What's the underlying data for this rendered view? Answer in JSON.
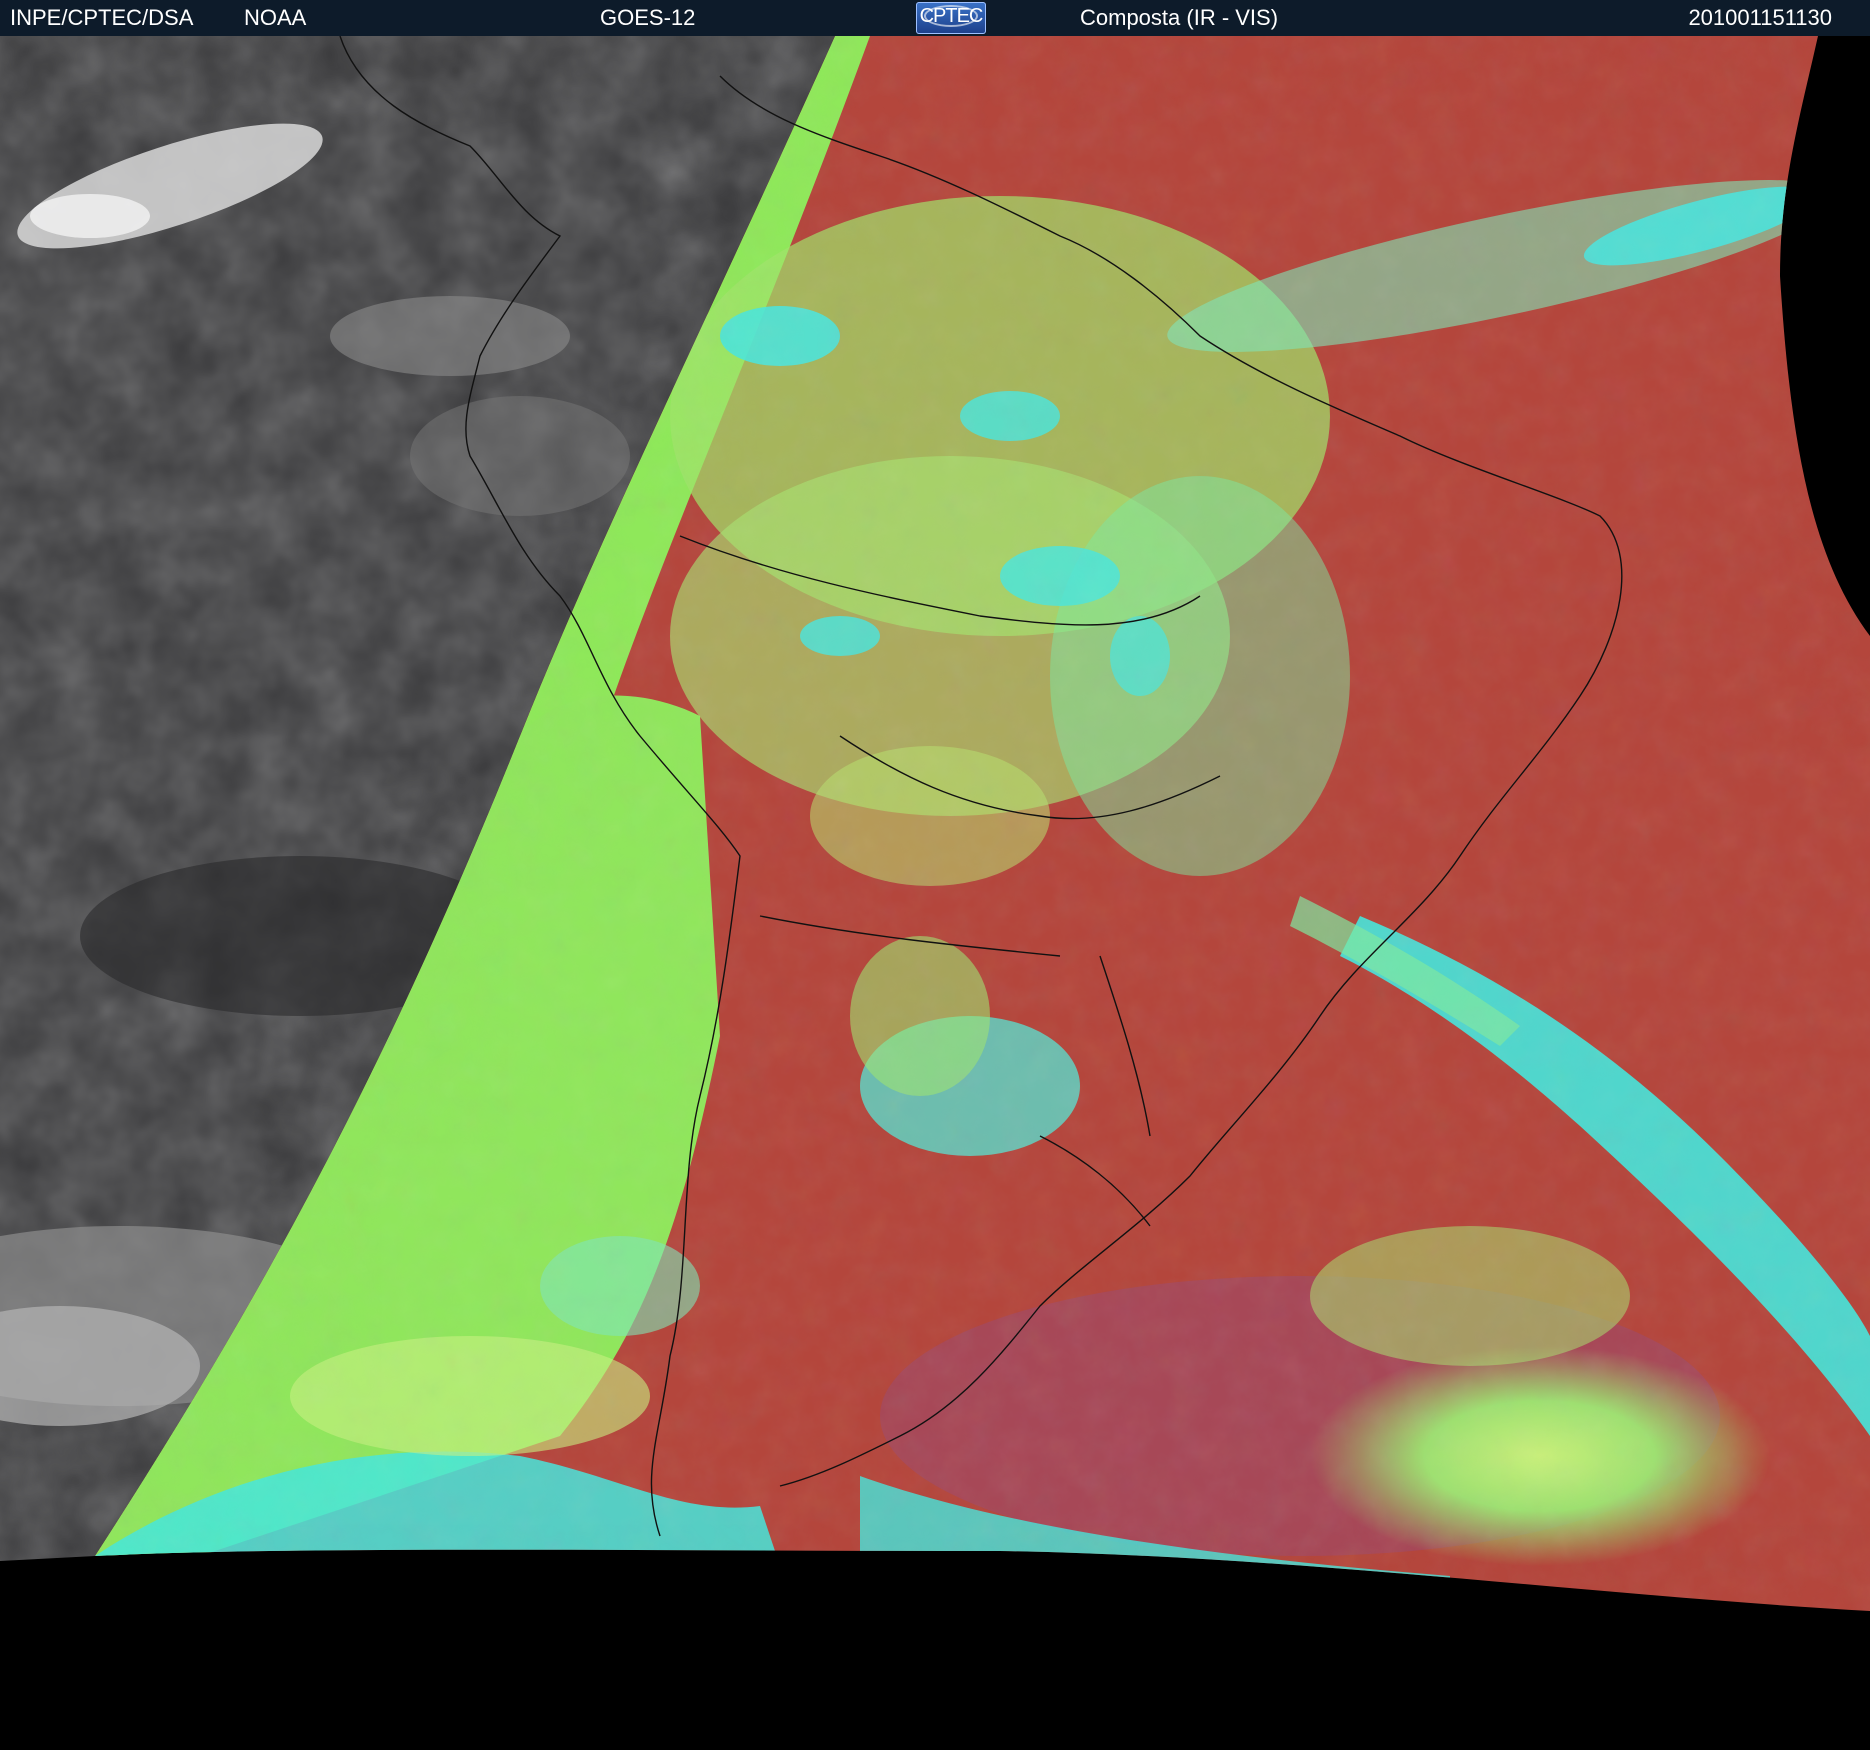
{
  "header": {
    "organization": "INPE/CPTEC/DSA",
    "agency": "NOAA",
    "satellite": "GOES-12",
    "product": "Composta (IR - VIS)",
    "timestamp": "201001151130"
  },
  "logo": {
    "text": "CPTEC"
  },
  "colors": {
    "header_bg": "#0d1b2a",
    "ir_ocean": "#3a3a3c",
    "composite_red": "#b4463c",
    "composite_green": "#8fe85a",
    "composite_cyan": "#3fe8e0",
    "outside_disk": "#000000"
  }
}
